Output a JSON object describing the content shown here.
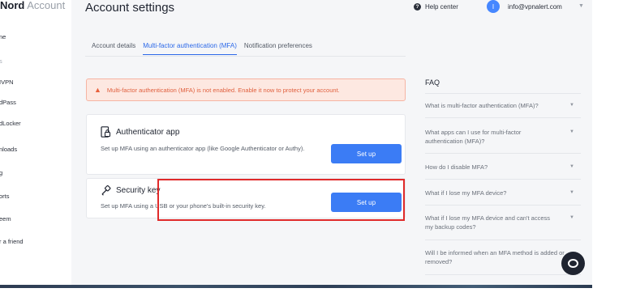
{
  "app": {
    "brand_bold": "Nord",
    "brand_light": "Account"
  },
  "sidebar": {
    "items": [
      {
        "label": "ne"
      },
      {
        "label": "s"
      },
      {
        "label": "IVPN"
      },
      {
        "label": "dPass"
      },
      {
        "label": "dLocker"
      },
      {
        "label": "nloads"
      },
      {
        "label": "g"
      },
      {
        "label": "orts"
      },
      {
        "label": "eem"
      },
      {
        "label": "r a friend"
      }
    ]
  },
  "header": {
    "title": "Account settings",
    "help_label": "Help center",
    "avatar_initial": "I",
    "email": "info@vpnalert.com"
  },
  "tabs": [
    {
      "label": "Account details"
    },
    {
      "label": "Multi-factor authentication (MFA)",
      "active": true
    },
    {
      "label": "Notification preferences"
    }
  ],
  "alert": {
    "text": "Multi-factor authentication (MFA) is not enabled. Enable it now to protect your account."
  },
  "methods": [
    {
      "title": "Authenticator app",
      "description": "Set up MFA using an authenticator app (like Google Authenticator or Authy).",
      "button": "Set up"
    },
    {
      "title": "Security key",
      "description": "Set up MFA using a USB or your phone's built-in security key.",
      "button": "Set up"
    }
  ],
  "faq": {
    "title": "FAQ",
    "items": [
      {
        "q": "What is multi-factor authentication (MFA)?"
      },
      {
        "q": "What apps can I use for multi-factor authentication (MFA)?"
      },
      {
        "q": "How do I disable MFA?"
      },
      {
        "q": "What if I lose my MFA device?"
      },
      {
        "q": "What if I lose my MFA device and can't access my backup codes?"
      },
      {
        "q": "Will I be informed when an MFA method is added or removed?"
      }
    ]
  },
  "colors": {
    "accent": "#3b7cf5",
    "alert_bg": "#fde8e1",
    "alert_text": "#e0603e",
    "highlight": "#e02a2a"
  },
  "icons": {
    "help": "question-circle-icon",
    "caret": "chevron-down-icon",
    "warning": "warning-triangle-icon",
    "authenticator": "phone-lock-icon",
    "key": "key-icon",
    "chat": "chat-bubble-icon"
  }
}
